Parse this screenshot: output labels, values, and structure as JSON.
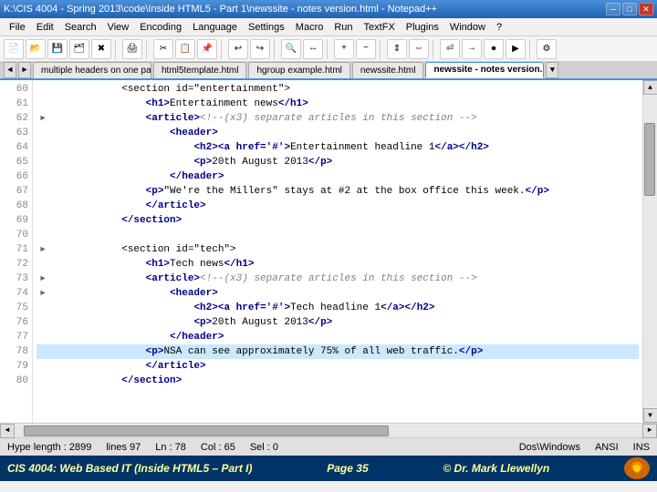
{
  "titleBar": {
    "title": "K:\\CIS 4004 - Spring 2013\\code\\Inside HTML5 - Part 1\\newssite - notes version.html - Notepad++",
    "minBtn": "─",
    "maxBtn": "□",
    "closeBtn": "✕"
  },
  "menu": {
    "items": [
      "File",
      "Edit",
      "Search",
      "View",
      "Encoding",
      "Language",
      "Settings",
      "Macro",
      "Run",
      "TextFX",
      "Plugins",
      "Window",
      "?"
    ]
  },
  "tabs": {
    "items": [
      {
        "label": "multiple headers on one page.ht...",
        "active": false
      },
      {
        "label": "html5template.html",
        "active": false
      },
      {
        "label": "hgroup example.html",
        "active": false
      },
      {
        "label": "newssite.html",
        "active": false
      },
      {
        "label": "newssite - notes version.html",
        "active": true
      }
    ]
  },
  "editor": {
    "lines": [
      {
        "num": "60",
        "indent": "            ",
        "fold": "",
        "code": "<section id=\"entertainment\">",
        "type": "tag"
      },
      {
        "num": "61",
        "indent": "                ",
        "fold": "",
        "code": "<h1>Entertainment news</h1>",
        "type": "tag"
      },
      {
        "num": "62",
        "indent": "                ",
        "fold": "►",
        "code": "<article><!--(x3) separate articles in this section -->",
        "type": "tag-comment"
      },
      {
        "num": "63",
        "indent": "                    ",
        "fold": "",
        "code": "<header>",
        "type": "tag"
      },
      {
        "num": "64",
        "indent": "                        ",
        "fold": "",
        "code": "<h2><a href='#'>Entertainment headline 1</a></h2>",
        "type": "tag"
      },
      {
        "num": "65",
        "indent": "                        ",
        "fold": "",
        "code": "<p>20th August 2013</p>",
        "type": "tag"
      },
      {
        "num": "66",
        "indent": "                    ",
        "fold": "",
        "code": "</header>",
        "type": "tag"
      },
      {
        "num": "67",
        "indent": "                ",
        "fold": "",
        "code": "<p>\"We're the Millers\" stays at #2 at the box office this week.</p>",
        "type": "tag"
      },
      {
        "num": "68",
        "indent": "                ",
        "fold": "",
        "code": "</article>",
        "type": "tag"
      },
      {
        "num": "69",
        "indent": "            ",
        "fold": "",
        "code": "</section>",
        "type": "tag"
      },
      {
        "num": "70",
        "indent": "",
        "fold": "",
        "code": "",
        "type": "empty"
      },
      {
        "num": "71",
        "indent": "            ",
        "fold": "►",
        "code": "<section id=\"tech\">",
        "type": "tag"
      },
      {
        "num": "72",
        "indent": "                ",
        "fold": "",
        "code": "<h1>Tech news</h1>",
        "type": "tag"
      },
      {
        "num": "73",
        "indent": "                ",
        "fold": "►",
        "code": "<article><!--(x3) separate articles in this section -->",
        "type": "tag-comment"
      },
      {
        "num": "74",
        "indent": "                    ",
        "fold": "►",
        "code": "<header>",
        "type": "tag"
      },
      {
        "num": "75",
        "indent": "                        ",
        "fold": "",
        "code": "<h2><a href='#'>Tech headline 1</a></h2>",
        "type": "tag"
      },
      {
        "num": "76",
        "indent": "                        ",
        "fold": "",
        "code": "<p>20th August 2013</p>",
        "type": "tag"
      },
      {
        "num": "77",
        "indent": "                    ",
        "fold": "",
        "code": "</header>",
        "type": "tag"
      },
      {
        "num": "78",
        "indent": "                ",
        "fold": "",
        "code": "<p>NSA can see approximately 75% of all web traffic.</p>",
        "type": "tag",
        "highlighted": true
      },
      {
        "num": "79",
        "indent": "                ",
        "fold": "",
        "code": "</article>",
        "type": "tag"
      },
      {
        "num": "80",
        "indent": "            ",
        "fold": "",
        "code": "</section>",
        "type": "tag"
      }
    ]
  },
  "statusBar": {
    "hype": "Hype length : 2899",
    "lines": "lines  97",
    "ln": "Ln : 78",
    "col": "Col : 65",
    "sel": "Sel : 0",
    "doswin": "Dos\\Windows",
    "ansi": "ANSI",
    "ins": "INS"
  },
  "footer": {
    "course": "CIS 4004: Web Based IT (Inside HTML5 – Part I)",
    "page": "Page 35",
    "author": "© Dr. Mark Llewellyn",
    "logoChar": "🔷"
  }
}
